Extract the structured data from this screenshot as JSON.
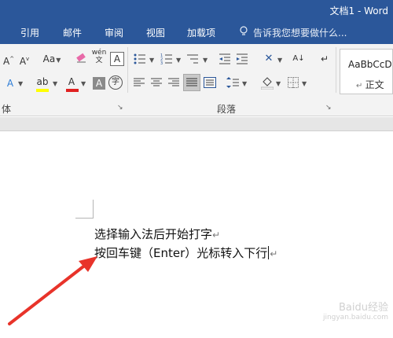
{
  "title_bar": {
    "title": "文档1 - Word"
  },
  "tabs": [
    {
      "label": "引用"
    },
    {
      "label": "邮件"
    },
    {
      "label": "审阅"
    },
    {
      "label": "视图"
    },
    {
      "label": "加载项"
    }
  ],
  "tell_me": {
    "placeholder": "告诉我您想要做什么..."
  },
  "ribbon": {
    "font_group": {
      "grow_font": "A",
      "shrink_font": "A",
      "change_case": "Aa",
      "phonetic_guide": "wén",
      "char_border": "A",
      "text_effects": "A",
      "highlight": "ab",
      "font_color": "A",
      "char_shading": "A",
      "enclose_char": "字",
      "label": "体"
    },
    "paragraph_group": {
      "label": "段落"
    },
    "styles_group": {
      "sample": "AaBbCcD",
      "style_name": "正文"
    }
  },
  "document": {
    "lines": [
      {
        "text": "选择输入法后开始打字",
        "mark": "↵"
      },
      {
        "text_before_cursor": "按回车键（Enter）光标转入下行",
        "mark": "↵"
      }
    ]
  },
  "watermark": {
    "text": "Baidu经验",
    "sub": "jingyan.baidu.com"
  },
  "colors": {
    "titlebar": "#2b579a",
    "highlight_yellow": "#ffff00",
    "font_red": "#e02020",
    "arrow_red": "#e8332a"
  }
}
